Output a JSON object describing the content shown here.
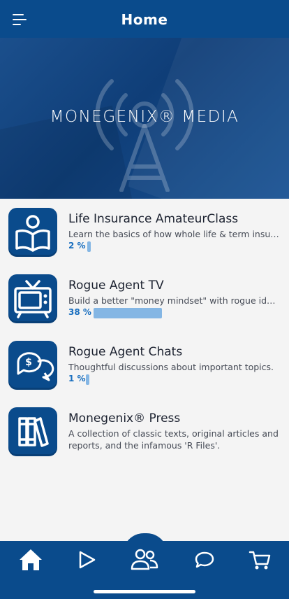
{
  "header": {
    "title": "Home"
  },
  "hero": {
    "title": "MONEGENIX® MEDIA"
  },
  "items": [
    {
      "title": "Life Insurance AmateurClass",
      "description": "Learn the basics of how whole life & term insurance work.",
      "progress_label": "2 %",
      "progress": 0.02,
      "icon": "reader-book-icon"
    },
    {
      "title": "Rogue Agent TV",
      "description": "Build a better \"money mindset\" with rogue ideas and videos.",
      "progress_label": "38 %",
      "progress": 0.38,
      "icon": "television-icon"
    },
    {
      "title": "Rogue Agent Chats",
      "description": "Thoughtful discussions about important topics.",
      "progress_label": "1 %",
      "progress": 0.01,
      "icon": "money-chat-icon"
    },
    {
      "title": "Monegenix® Press",
      "description": "A collection of classic texts, original articles and reports, and the infamous 'R Files'.",
      "icon": "books-icon"
    }
  ],
  "tabs": [
    "home-icon",
    "play-icon",
    "community-icon",
    "chat-icon",
    "cart-icon"
  ],
  "colors": {
    "primary": "#0a4b8c",
    "progress": "#84b6e4",
    "progress_text": "#1a6fbf"
  }
}
